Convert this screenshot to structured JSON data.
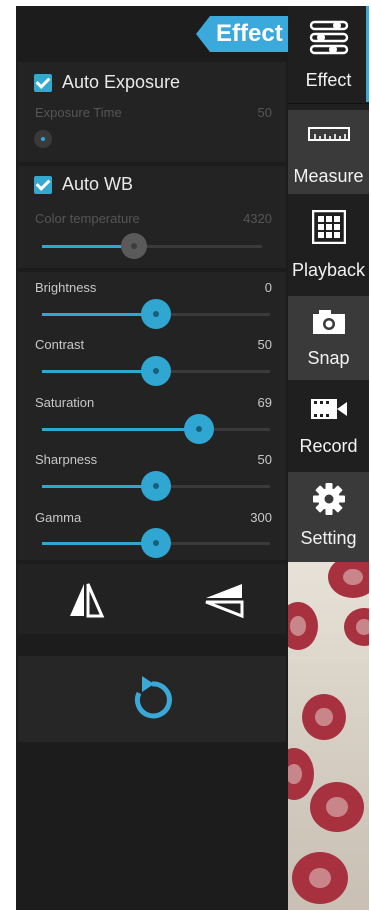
{
  "header": {
    "effect_label": "Effect"
  },
  "exposure": {
    "auto_label": "Auto Exposure",
    "time_label": "Exposure Time",
    "time_value": "50"
  },
  "white_balance": {
    "auto_label": "Auto WB",
    "temp_label": "Color temperature",
    "temp_value": "4320"
  },
  "sliders": [
    {
      "label": "Brightness",
      "value": "0"
    },
    {
      "label": "Contrast",
      "value": "50"
    },
    {
      "label": "Saturation",
      "value": "69"
    },
    {
      "label": "Sharpness",
      "value": "50"
    },
    {
      "label": "Gamma",
      "value": "300"
    }
  ],
  "slider_levels": {
    "temperature": 0.42,
    "brightness": 0.5,
    "contrast": 0.5,
    "saturation": 0.69,
    "sharpness": 0.5,
    "gamma": 0.5
  },
  "nav": [
    {
      "label": "Effect",
      "icon": "sliders-icon"
    },
    {
      "label": "Measure",
      "icon": "ruler-icon"
    },
    {
      "label": "Playback",
      "icon": "grid-icon"
    },
    {
      "label": "Snap",
      "icon": "camera-icon"
    },
    {
      "label": "Record",
      "icon": "video-icon"
    },
    {
      "label": "Setting",
      "icon": "gear-icon"
    }
  ],
  "colors": {
    "accent": "#2fa7d2",
    "panel": "#1c1c1c",
    "nav_light": "#3a3a3a"
  }
}
